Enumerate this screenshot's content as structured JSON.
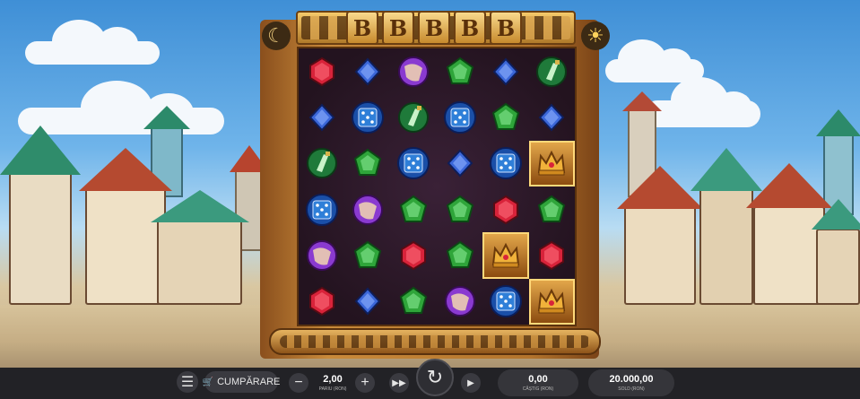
{
  "reel_header": {
    "multipliers": [
      "B",
      "B",
      "B",
      "B",
      "B"
    ],
    "left_corner_icon": "moon-icon",
    "right_corner_icon": "sun-icon"
  },
  "grid": [
    [
      "red-gem",
      "blue-gem",
      "purple-orb",
      "green-gem",
      "blue-gem",
      "green-potion"
    ],
    [
      "blue-gem",
      "blue-dice",
      "green-potion",
      "blue-dice",
      "green-gem",
      "blue-gem"
    ],
    [
      "green-potion",
      "green-gem",
      "blue-dice",
      "blue-gem",
      "blue-dice",
      "crown"
    ],
    [
      "blue-dice",
      "purple-orb",
      "green-gem",
      "green-gem",
      "red-gem",
      "green-gem"
    ],
    [
      "purple-orb",
      "green-gem",
      "red-gem",
      "green-gem",
      "crown",
      "red-gem"
    ],
    [
      "red-gem",
      "blue-gem",
      "green-gem",
      "purple-orb",
      "blue-dice",
      "crown"
    ]
  ],
  "controls": {
    "menu_icon": "hamburger-icon",
    "buy_icon": "cart-icon",
    "buy_label": "CUMPĂRARE",
    "minus_label": "−",
    "plus_label": "+",
    "bet_value": "2,00",
    "bet_label": "PARIU (RON)",
    "turbo_icon": "fast-forward-icon",
    "spin_icon": "refresh-icon",
    "autoplay_icon": "play-icon",
    "win_value": "0,00",
    "win_label": "CÂȘTIG (RON)",
    "balance_value": "20.000,00",
    "balance_label": "SOLD (RON)"
  },
  "colors": {
    "red_gem": "#d8233a",
    "blue_gem": "#3a66d8",
    "green_gem": "#2fa53a",
    "purple_orb": "#8a3ad0",
    "blue_dice": "#2f7fd8",
    "crown_gold": "#f0b23a",
    "frame_wood": "#b3742c",
    "bar_bg": "#222226"
  }
}
